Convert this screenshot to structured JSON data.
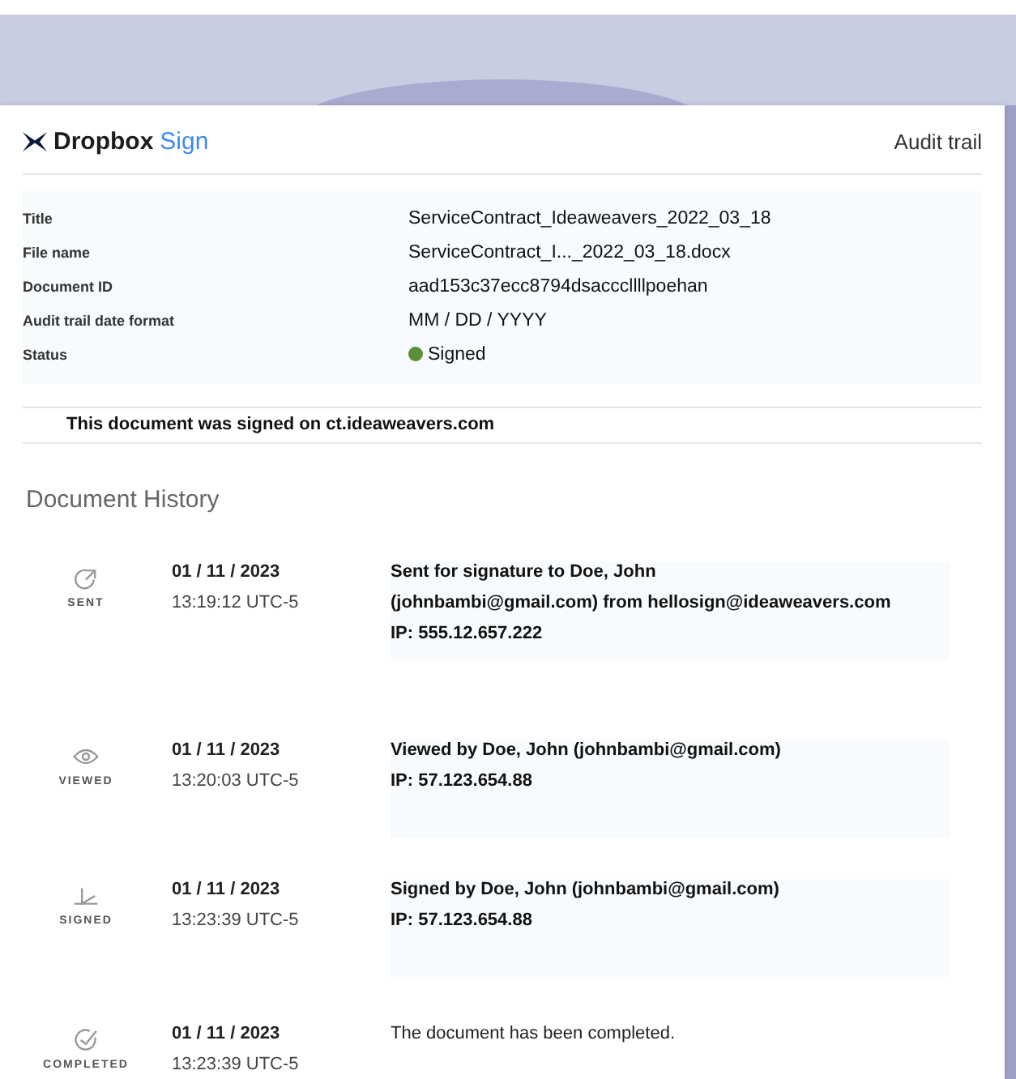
{
  "header": {
    "brand": "Dropbox",
    "brand_accent": "Sign",
    "title": "Audit trail"
  },
  "details": [
    {
      "label": "Title",
      "value": "ServiceContract_Ideaweavers_2022_03_18"
    },
    {
      "label": "File name",
      "value": "ServiceContract_I..._2022_03_18.docx"
    },
    {
      "label": "Document ID",
      "value": "aad153c37ecc8794dsacccllllpoehan"
    },
    {
      "label": "Audit trail date format",
      "value": "MM / DD /  YYYY"
    }
  ],
  "status": {
    "label": "Status",
    "value": "Signed",
    "color": "#5a8f3c"
  },
  "signed_on": "This document was signed on ct.ideaweavers.com",
  "history_title": "Document History",
  "events": [
    {
      "kind": "sent",
      "label": "SENT",
      "date": "01 / 11 / 2023",
      "time": "13:19:12 UTC-5",
      "bold": true,
      "lines": [
        "Sent for signature to Doe, John",
        "(johnbambi@gmail.com) from hellosign@ideaweavers.com",
        "IP: 555.12.657.222"
      ]
    },
    {
      "kind": "viewed",
      "label": "VIEWED",
      "date": "01 / 11 / 2023",
      "time": "13:20:03 UTC-5",
      "bold": true,
      "lines": [
        "Viewed by Doe, John (johnbambi@gmail.com)",
        "IP: 57.123.654.88"
      ]
    },
    {
      "kind": "signed",
      "label": "SIGNED",
      "date": "01 / 11 / 2023",
      "time": "13:23:39 UTC-5",
      "bold": true,
      "lines": [
        "Signed by Doe, John (johnbambi@gmail.com)",
        "IP: 57.123.654.88"
      ]
    },
    {
      "kind": "completed",
      "label": "COMPLETED",
      "date": "01 / 11 / 2023",
      "time": "13:23:39 UTC-5",
      "bold": false,
      "lines": [
        "The document has been completed."
      ]
    }
  ]
}
